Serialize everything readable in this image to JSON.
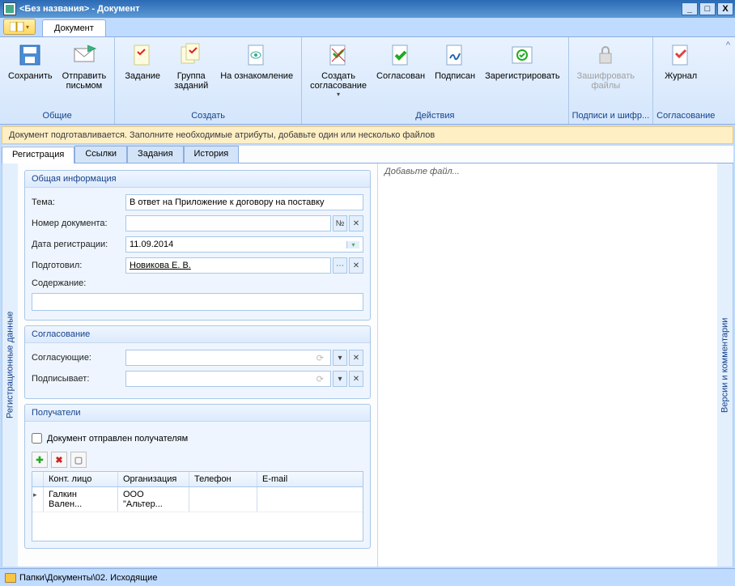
{
  "title": "<Без названия> - Документ",
  "apptabs": {
    "document": "Документ"
  },
  "ribbon": {
    "collapse": "^",
    "groups": [
      {
        "label": "Общие",
        "items": [
          {
            "name": "save-button",
            "label": "Сохранить"
          },
          {
            "name": "send-email-button",
            "label": "Отправить\nписьмом"
          }
        ]
      },
      {
        "label": "Создать",
        "items": [
          {
            "name": "task-button",
            "label": "Задание"
          },
          {
            "name": "task-group-button",
            "label": "Группа\nзаданий"
          },
          {
            "name": "review-button",
            "label": "На ознакомление"
          }
        ]
      },
      {
        "label": "Действия",
        "items": [
          {
            "name": "create-approval-button",
            "label": "Создать\nсогласование",
            "dropdown": true
          },
          {
            "name": "approved-button",
            "label": "Согласован"
          },
          {
            "name": "signed-button",
            "label": "Подписан"
          },
          {
            "name": "register-button",
            "label": "Зарегистрировать"
          }
        ]
      },
      {
        "label": "Подписи и шифр...",
        "items": [
          {
            "name": "encrypt-button",
            "label": "Зашифровать\nфайлы",
            "disabled": true
          }
        ]
      },
      {
        "label": "Согласование",
        "items": [
          {
            "name": "journal-button",
            "label": "Журнал"
          }
        ]
      }
    ]
  },
  "infobar": "Документ подготавливается. Заполните необходимые атрибуты, добавьте один или несколько файлов",
  "doctabs": [
    "Регистрация",
    "Ссылки",
    "Задания",
    "История"
  ],
  "activeDocTab": 0,
  "sidebars": {
    "left": "Регистрационные данные",
    "right": "Версии и комментарии"
  },
  "general": {
    "title": "Общая информация",
    "fields": {
      "subject_lbl": "Тема:",
      "subject": "В ответ на Приложение к договору на поставку",
      "docnum_lbl": "Номер документа:",
      "docnum": "",
      "docnum_btn": "№",
      "regdate_lbl": "Дата регистрации:",
      "regdate": "11.09.2014",
      "preparedby_lbl": "Подготовил:",
      "preparedby": "Новикова Е. В.",
      "content_lbl": "Содержание:",
      "content": ""
    }
  },
  "approval": {
    "title": "Согласование",
    "fields": {
      "approvers_lbl": "Согласующие:",
      "approvers": "",
      "signer_lbl": "Подписывает:",
      "signer": ""
    }
  },
  "recipients": {
    "title": "Получатели",
    "sent_lbl": "Документ отправлен получателям",
    "columns": [
      "Конт. лицо",
      "Организация",
      "Телефон",
      "E-mail"
    ],
    "rows": [
      {
        "contact": "Галкин Вален...",
        "org": "ООО \"Альтер...",
        "phone": "",
        "email": ""
      }
    ]
  },
  "fileplaceholder": "Добавьте файл...",
  "statusbar": "Папки\\Документы\\02. Исходящие"
}
